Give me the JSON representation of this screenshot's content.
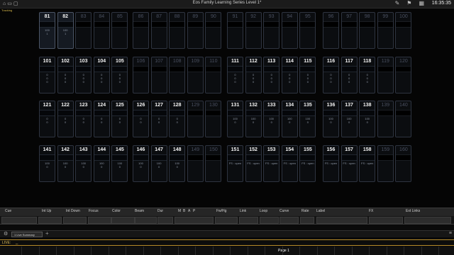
{
  "app": {
    "title": "Eos Family Learning Series Level 1*",
    "clock": "16:35:35",
    "mode": "Tracking"
  },
  "toolbar": {
    "left_icons": [
      "home-icon",
      "display-icon",
      "window-icon"
    ],
    "right_icons": [
      "pen-icon",
      "flag-icon",
      "grid-icon"
    ]
  },
  "channels": [
    {
      "num": "81",
      "state": "full",
      "i1": "100",
      "i2": "1"
    },
    {
      "num": "82",
      "state": "full",
      "i1": "100",
      "i2": "1"
    },
    {
      "num": "83",
      "state": "dim"
    },
    {
      "num": "84",
      "state": "dim"
    },
    {
      "num": "85",
      "state": "dim"
    },
    {
      "num": "86",
      "state": "dim"
    },
    {
      "num": "87",
      "state": "dim"
    },
    {
      "num": "88",
      "state": "dim"
    },
    {
      "num": "89",
      "state": "dim"
    },
    {
      "num": "90",
      "state": "dim"
    },
    {
      "num": "91",
      "state": "dim"
    },
    {
      "num": "92",
      "state": "dim"
    },
    {
      "num": "93",
      "state": "dim"
    },
    {
      "num": "94",
      "state": "dim"
    },
    {
      "num": "95",
      "state": "dim"
    },
    {
      "num": "96",
      "state": "dim"
    },
    {
      "num": "97",
      "state": "dim"
    },
    {
      "num": "98",
      "state": "dim"
    },
    {
      "num": "99",
      "state": "dim"
    },
    {
      "num": "100",
      "state": "dim"
    },
    {
      "num": "101",
      "state": "on",
      "i1": "0",
      "i2": "0",
      "i3": "0"
    },
    {
      "num": "102",
      "state": "on",
      "i1": "0",
      "i2": "0",
      "i3": "0"
    },
    {
      "num": "103",
      "state": "on",
      "i1": "0",
      "i2": "0",
      "i3": "0"
    },
    {
      "num": "104",
      "state": "on",
      "i1": "0",
      "i2": "0",
      "i3": "0"
    },
    {
      "num": "105",
      "state": "on",
      "i1": "0",
      "i2": "0",
      "i3": "0"
    },
    {
      "num": "106",
      "state": "dim"
    },
    {
      "num": "107",
      "state": "dim"
    },
    {
      "num": "108",
      "state": "dim"
    },
    {
      "num": "109",
      "state": "dim"
    },
    {
      "num": "110",
      "state": "dim"
    },
    {
      "num": "111",
      "state": "on",
      "i1": "0",
      "i2": "0",
      "i3": "0"
    },
    {
      "num": "112",
      "state": "on",
      "i1": "0",
      "i2": "0",
      "i3": "0"
    },
    {
      "num": "113",
      "state": "on",
      "i1": "0",
      "i2": "0",
      "i3": "0"
    },
    {
      "num": "114",
      "state": "on",
      "i1": "0",
      "i2": "0",
      "i3": "0"
    },
    {
      "num": "115",
      "state": "on",
      "i1": "0",
      "i2": "0",
      "i3": "0"
    },
    {
      "num": "116",
      "state": "on",
      "i1": "0",
      "i2": "0",
      "i3": "0"
    },
    {
      "num": "117",
      "state": "on",
      "i1": "0",
      "i2": "0",
      "i3": "0"
    },
    {
      "num": "118",
      "state": "on",
      "i1": "0",
      "i2": "0",
      "i3": "0"
    },
    {
      "num": "119",
      "state": "dim"
    },
    {
      "num": "120",
      "state": "dim"
    },
    {
      "num": "121",
      "state": "on",
      "i1": "0",
      "i2": "0"
    },
    {
      "num": "122",
      "state": "on",
      "i1": "0",
      "i2": "0"
    },
    {
      "num": "123",
      "state": "on",
      "i1": "0",
      "i2": "0"
    },
    {
      "num": "124",
      "state": "on",
      "i1": "0",
      "i2": "0"
    },
    {
      "num": "125",
      "state": "on",
      "i1": "0",
      "i2": "0"
    },
    {
      "num": "126",
      "state": "on",
      "i1": "0",
      "i2": "0"
    },
    {
      "num": "127",
      "state": "on",
      "i1": "0",
      "i2": "0"
    },
    {
      "num": "128",
      "state": "on",
      "i1": "0",
      "i2": "0"
    },
    {
      "num": "129",
      "state": "dim"
    },
    {
      "num": "130",
      "state": "dim"
    },
    {
      "num": "131",
      "state": "on",
      "i1": "100",
      "i2": "0"
    },
    {
      "num": "132",
      "state": "on",
      "i1": "100",
      "i2": "0"
    },
    {
      "num": "133",
      "state": "on",
      "i1": "100",
      "i2": "0"
    },
    {
      "num": "134",
      "state": "on",
      "i1": "100",
      "i2": "0"
    },
    {
      "num": "135",
      "state": "on",
      "i1": "100",
      "i2": "0"
    },
    {
      "num": "136",
      "state": "on",
      "i1": "100",
      "i2": "0"
    },
    {
      "num": "137",
      "state": "on",
      "i1": "100",
      "i2": "0"
    },
    {
      "num": "138",
      "state": "on",
      "i1": "100",
      "i2": "0"
    },
    {
      "num": "139",
      "state": "dim"
    },
    {
      "num": "140",
      "state": "dim"
    },
    {
      "num": "141",
      "state": "on",
      "i1": "100",
      "i2": "0"
    },
    {
      "num": "142",
      "state": "on",
      "i1": "100",
      "i2": "0"
    },
    {
      "num": "143",
      "state": "on",
      "i1": "100",
      "i2": "0"
    },
    {
      "num": "144",
      "state": "on",
      "i1": "100",
      "i2": "0"
    },
    {
      "num": "145",
      "state": "on",
      "i1": "100",
      "i2": "0"
    },
    {
      "num": "146",
      "state": "on",
      "i1": "100",
      "i2": "0"
    },
    {
      "num": "147",
      "state": "on",
      "i1": "100",
      "i2": "0"
    },
    {
      "num": "148",
      "state": "on",
      "i1": "100",
      "i2": "0"
    },
    {
      "num": "149",
      "state": "dim"
    },
    {
      "num": "150",
      "state": "dim"
    },
    {
      "num": "151",
      "state": "on",
      "i1": "FS : open"
    },
    {
      "num": "152",
      "state": "on",
      "i1": "FS : open"
    },
    {
      "num": "153",
      "state": "on",
      "i1": "FS : open"
    },
    {
      "num": "154",
      "state": "on",
      "i1": "FS : open"
    },
    {
      "num": "155",
      "state": "on",
      "i1": "FS : open"
    },
    {
      "num": "156",
      "state": "on",
      "i1": "FS : open"
    },
    {
      "num": "157",
      "state": "on",
      "i1": "FS : open"
    },
    {
      "num": "158",
      "state": "on",
      "i1": "FS : open"
    },
    {
      "num": "159",
      "state": "dim"
    },
    {
      "num": "160",
      "state": "dim"
    }
  ],
  "cue_headers": [
    "Cue",
    "Int Up",
    "Int Down",
    "Focus",
    "Color",
    "Beam",
    "Dur",
    "M",
    "B",
    "A",
    "P",
    "Fw/Hg",
    "Link",
    "Loop",
    "Curve",
    "Rate",
    "Label",
    "FX",
    "Ext Links"
  ],
  "tab": {
    "label": "1 Live Summary"
  },
  "command_line": {
    "label": "LIVE:",
    "value": "_"
  },
  "page": "Page 1"
}
